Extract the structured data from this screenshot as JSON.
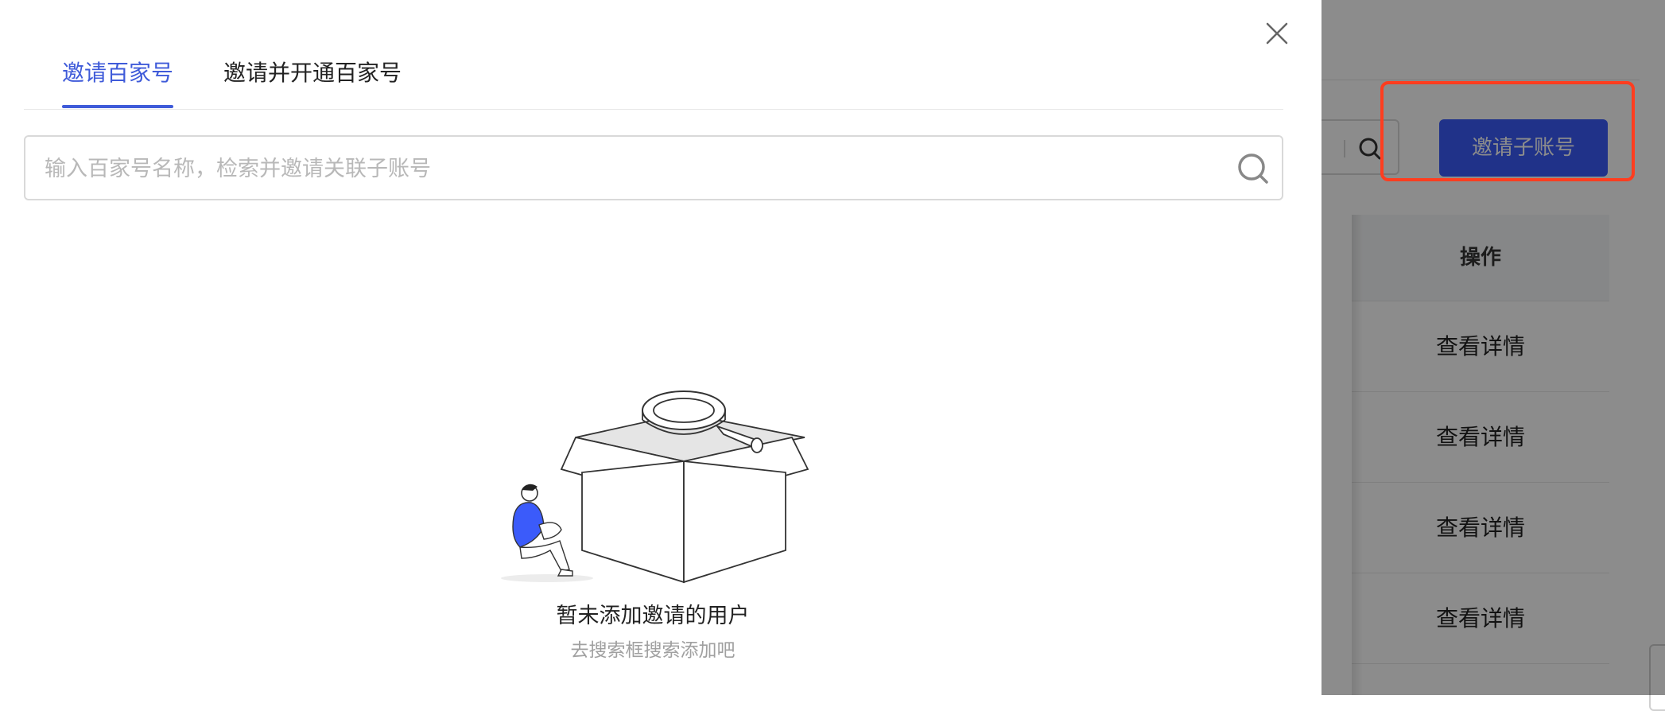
{
  "drawer": {
    "tabs": [
      {
        "label": "邀请百家号",
        "active": true
      },
      {
        "label": "邀请并开通百家号",
        "active": false
      }
    ],
    "search": {
      "placeholder": "输入百家号名称，检索并邀请关联子账号",
      "value": ""
    },
    "empty_state": {
      "title": "暂未添加邀请的用户",
      "subtitle": "去搜索框搜索添加吧"
    }
  },
  "background": {
    "invite_button_label": "邀请子账号",
    "table": {
      "header": "操作",
      "rows": [
        "查看详情",
        "查看详情",
        "查看详情",
        "查看详情"
      ]
    }
  },
  "colors": {
    "accent": "#3f5bd9",
    "primary_button": "#3b5bfa",
    "highlight": "#ff3d1f"
  },
  "icons": [
    "close-icon",
    "search-icon"
  ]
}
